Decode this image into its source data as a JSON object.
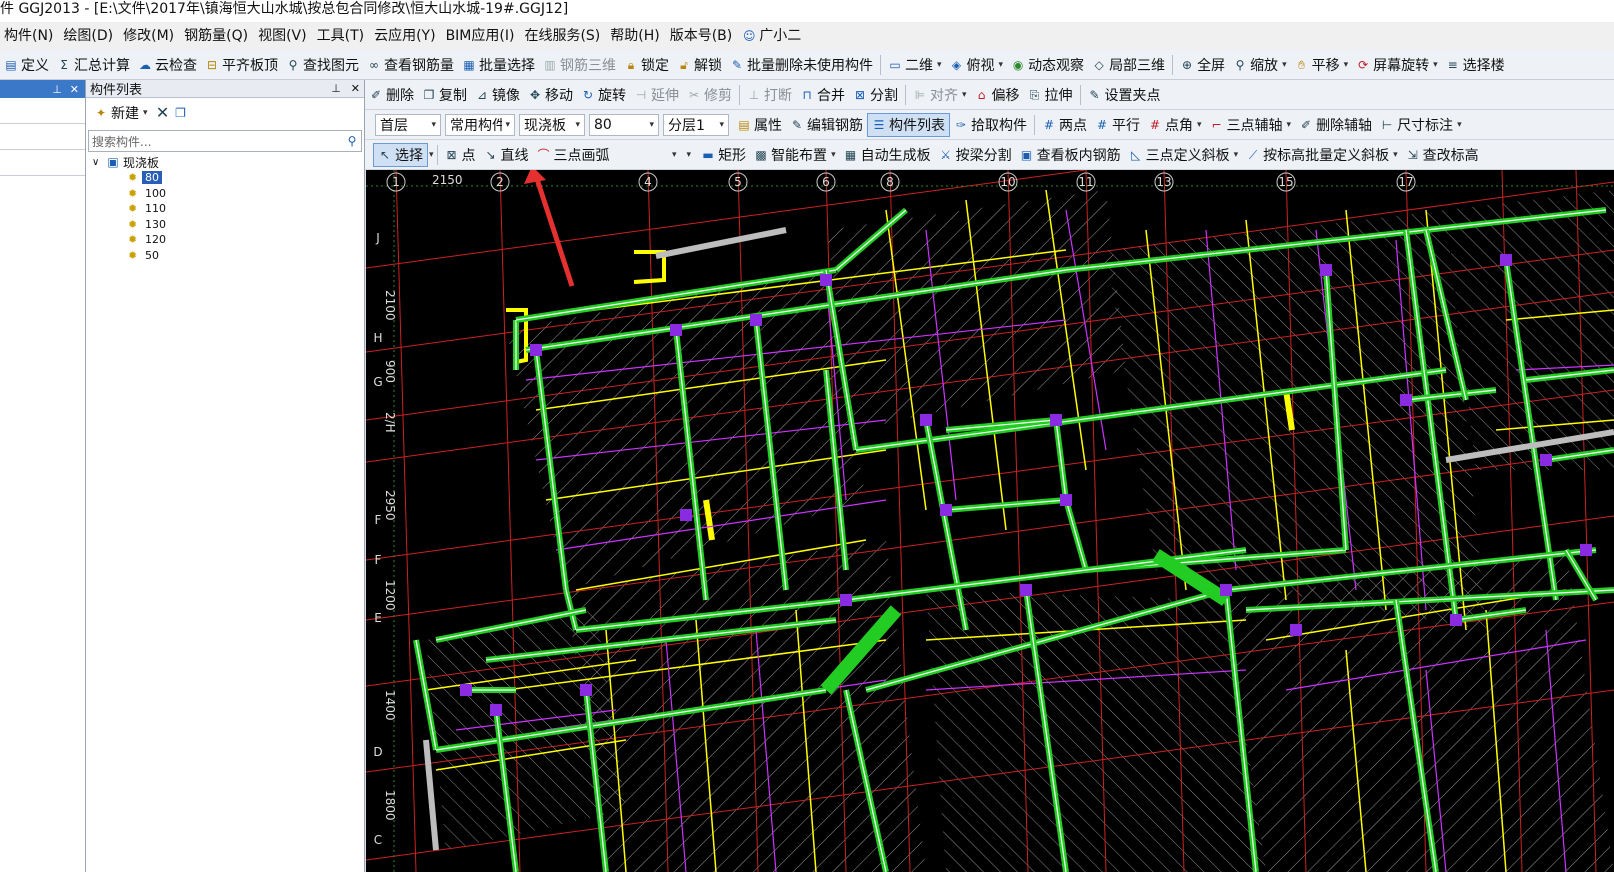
{
  "title": "件 GGJ2013 - [E:\\文件\\2017年\\镇海恒大山水城\\按总包合同修改\\恒大山水城-19#.GGJ12]",
  "menu": [
    "构件(N)",
    "绘图(D)",
    "修改(M)",
    "钢筋量(Q)",
    "视图(V)",
    "工具(T)",
    "云应用(Y)",
    "BIM应用(I)",
    "在线服务(S)",
    "帮助(H)",
    "版本号(B)",
    "广小二"
  ],
  "toolbar1": {
    "define": "定义",
    "summary_calc": "汇总计算",
    "cloud_check": "云检查",
    "flush_slab": "平齐板顶",
    "find_element": "查找图元",
    "view_rebar_qty": "查看钢筋量",
    "batch_select": "批量选择",
    "rebar_3d": "钢筋三维",
    "lock": "锁定",
    "unlock": "解锁",
    "batch_delete_unused": "批量删除未使用构件",
    "view_2d": "二维",
    "top_view": "俯视",
    "dynamic_view": "动态观察",
    "local_3d": "局部三维",
    "full_screen": "全屏",
    "zoom": "缩放",
    "pan": "平移",
    "screen_rotate": "屏幕旋转",
    "select_floor": "选择楼"
  },
  "toolbar2": {
    "delete": "删除",
    "copy": "复制",
    "mirror": "镜像",
    "move": "移动",
    "rotate": "旋转",
    "extend": "延伸",
    "trim": "修剪",
    "break": "打断",
    "merge": "合并",
    "split": "分割",
    "align": "对齐",
    "offset": "偏移",
    "stretch": "拉伸",
    "set_grip": "设置夹点"
  },
  "toolbar3": {
    "floor": "首层",
    "category": "常用构件",
    "type": "现浇板",
    "component": "80",
    "layer": "分层1",
    "properties": "属性",
    "edit_rebar": "编辑钢筋",
    "component_list": "构件列表",
    "pick_component": "拾取构件",
    "two_points": "两点",
    "parallel": "平行",
    "point_angle": "点角",
    "three_point_axis": "三点辅轴",
    "delete_axis": "删除辅轴",
    "dimension": "尺寸标注"
  },
  "toolbar4": {
    "select": "选择",
    "point": "点",
    "line": "直线",
    "arc": "三点画弧",
    "rect": "矩形",
    "smart_layout": "智能布置",
    "auto_generate": "自动生成板",
    "split_by_beam": "按梁分割",
    "view_slab_rebar": "查看板内钢筋",
    "three_point_slope": "三点定义斜板",
    "batch_slope": "按标高批量定义斜板",
    "check_elevation": "查改标高"
  },
  "component_panel": {
    "title": "构件列表",
    "new_label": "新建",
    "search_placeholder": "搜索构件...",
    "root": "现浇板",
    "items": [
      "80",
      "100",
      "110",
      "130",
      "120",
      "50"
    ],
    "selected": "80"
  },
  "grid_labels": {
    "top": [
      "1",
      "2",
      "4",
      "5",
      "6",
      "8",
      "10",
      "11",
      "13",
      "15",
      "17"
    ],
    "top_dim": "2150",
    "left": [
      "J",
      "H",
      "G",
      "F",
      "F",
      "E",
      "D",
      "C"
    ],
    "left_dims": [
      "2100",
      "900",
      "2/H",
      "2950",
      "1200",
      "1400",
      "1800"
    ]
  },
  "colors": {
    "canvas_bg": "#000000",
    "wall": "#22cc22",
    "beam": "#ffff00",
    "grid": "#cc2222",
    "rebar": "#cc33ff",
    "annotation_arrow": "#e53030"
  }
}
